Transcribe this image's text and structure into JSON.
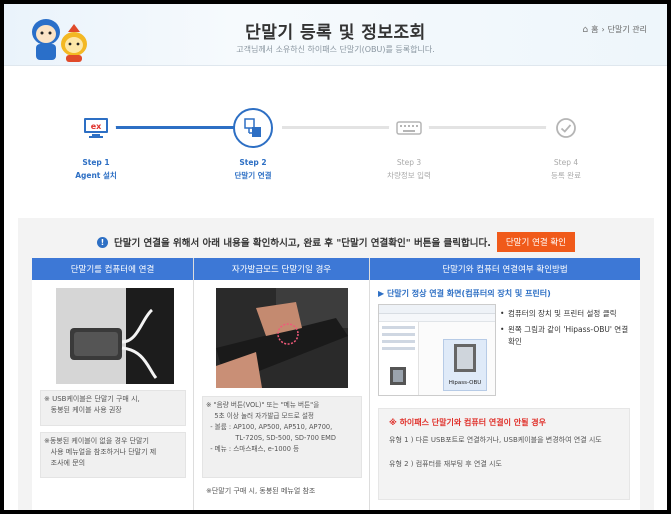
{
  "header": {
    "title": "단말기 등록 및 정보조회",
    "subtitle": "고객님께서 소유하신 하이패스 단말기(OBU)를 등록합니다.",
    "breadcrumb": [
      "홈",
      "단말기 관리"
    ]
  },
  "steps": [
    {
      "num": "Step 1",
      "label": "Agent 설치",
      "state": "done",
      "icon": "ex-monitor-icon"
    },
    {
      "num": "Step 2",
      "label": "단말기 연결",
      "state": "active",
      "icon": "device-connect-icon"
    },
    {
      "num": "Step 3",
      "label": "차량정보 입력",
      "state": "todo",
      "icon": "keyboard-icon"
    },
    {
      "num": "Step 4",
      "label": "등록 완료",
      "state": "todo",
      "icon": "check-circle-icon"
    }
  ],
  "notice": {
    "text": "단말기 연결을 위해서 아래 내용을 확인하시고, 완료 후 \"단말기 연결확인\" 버튼을 클릭합니다.",
    "button": "단말기 연결 확인"
  },
  "columns": {
    "col1": {
      "head": "단말기를 컴퓨터에 연결",
      "notes": [
        "※ USB케이블은 단말기 구매 시,\n   동봉된 케이블 사용 권장",
        "※동봉된 케이블이 없을 경우 단말기\n   사용 메뉴얼을 참조하거나 단말기 제\n   조사에 문의"
      ]
    },
    "col2": {
      "head": "자가발급모드 단말기일 경우",
      "notes": [
        "※ \"음량 버튼(VOL)\" 또는 \"메뉴 버튼\"을\n    5초 이상 눌러 자가발급 모드로 설정\n  - 볼륨 : AP100, AP500, AP510, AP700,\n              TL-720S, SD-500, SD-700 EMD\n  - 메뉴 : 스마스패스, e-1000 등",
        "※단말기 구매 시, 동봉된 메뉴얼 참조"
      ]
    },
    "col3": {
      "head": "단말기와 컴퓨터 연결여부 확인방법",
      "subhead": "단말기 정상 연결 화면(컴퓨터의 장치 및 프린터)",
      "bullets": [
        "컴퓨터의 장치 및 프린터 설정 클릭",
        "왼쪽 그림과 같이 'Hipass-OBU' 연결 확인"
      ],
      "window_label": "Hipass-OBU",
      "warn_title": "※ 하이패스 단말기와 컴퓨터 연결이 안될 경우",
      "warn_lines": [
        "유형 1 ) 다른 USB포트로 연결하거나, USB케이블을 변경하여 연결 시도",
        "유형 2 ) 컴퓨터를 재부팅 후 연결 시도"
      ]
    }
  },
  "colors": {
    "accent": "#2d6fc4",
    "header_blue": "#3d78d6",
    "button_orange": "#f05a1a",
    "warn_red": "#e0312b"
  }
}
